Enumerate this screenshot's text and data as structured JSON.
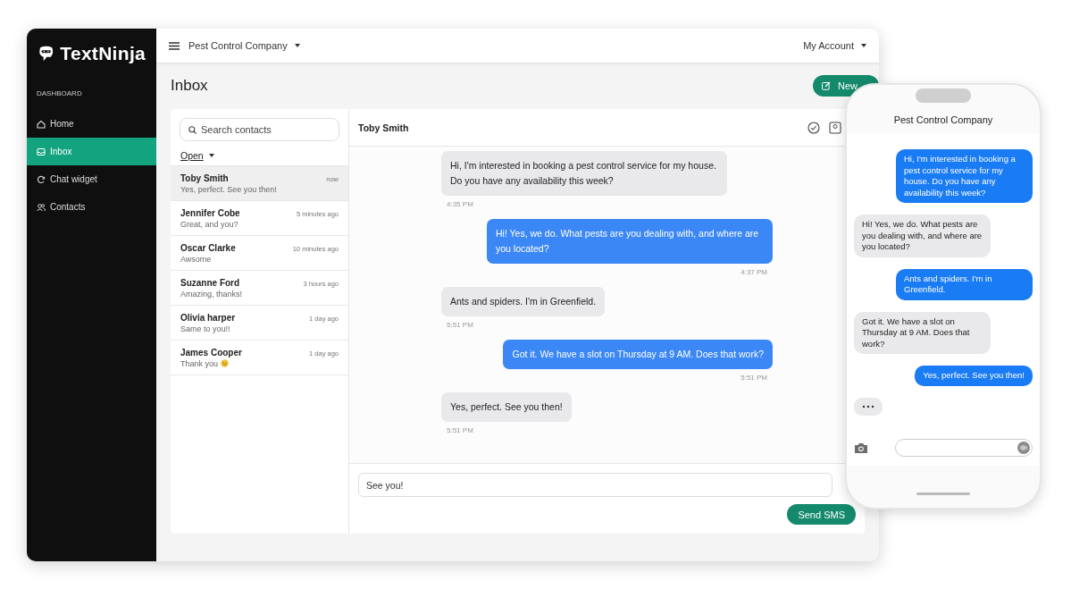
{
  "brand": {
    "name": "TextNinja"
  },
  "sidebar": {
    "section": "DASHBOARD",
    "items": [
      {
        "label": "Home",
        "selected": false
      },
      {
        "label": "Inbox",
        "selected": true
      },
      {
        "label": "Chat widget",
        "selected": false
      },
      {
        "label": "Contacts",
        "selected": false
      }
    ]
  },
  "topbar": {
    "company": "Pest Control Company",
    "account": "My Account"
  },
  "page": {
    "title": "Inbox",
    "new_button": "New"
  },
  "contacts": {
    "search_placeholder": "Search contacts",
    "filter": "Open",
    "items": [
      {
        "name": "Toby Smith",
        "preview": "Yes, perfect. See you then!",
        "time": "now",
        "emoji": false,
        "selected": true
      },
      {
        "name": "Jennifer Cobe",
        "preview": "Great, and you?",
        "time": "5 minutes ago",
        "emoji": false,
        "selected": false
      },
      {
        "name": "Oscar Clarke",
        "preview": "Awsome",
        "time": "10 minutes ago",
        "emoji": false,
        "selected": false
      },
      {
        "name": "Suzanne Ford",
        "preview": "Amazing, thanks!",
        "time": "3 hours ago",
        "emoji": false,
        "selected": false
      },
      {
        "name": "Olivia harper",
        "preview": "Same to you!!",
        "time": "1 day ago",
        "emoji": false,
        "selected": false
      },
      {
        "name": "James Cooper",
        "preview": "Thank you",
        "time": "1 day ago",
        "emoji": true,
        "selected": false
      }
    ]
  },
  "chat": {
    "contact": "Toby Smith",
    "messages": [
      {
        "kind": "in",
        "text": "Hi, I'm interested in booking a pest control service for my house. Do you have any availability this week?",
        "time": "4:35 PM"
      },
      {
        "kind": "out",
        "text": "Hi! Yes, we do. What pests are you dealing with, and where are you located?",
        "time": "4:37 PM"
      },
      {
        "kind": "in",
        "text": "Ants and spiders. I'm in Greenfield.",
        "time": "5:51 PM"
      },
      {
        "kind": "out",
        "text": "Got it. We have a slot on Thursday at 9 AM. Does that work?",
        "time": "5:51 PM"
      },
      {
        "kind": "in",
        "text": "Yes, perfect. See you then!",
        "time": "5:51 PM"
      }
    ],
    "composer_value": "See you!",
    "send_button": "Send SMS"
  },
  "phone": {
    "title": "Pest Control Company",
    "messages": [
      {
        "kind": "out",
        "text": "Hi, I'm interested in booking a pest control service for my house. Do you have any availability this week?"
      },
      {
        "kind": "in",
        "text": "Hi! Yes, we do. What pests are you dealing with, and where are you located?"
      },
      {
        "kind": "out",
        "text": "Ants and spiders. I'm in Greenfield."
      },
      {
        "kind": "in",
        "text": "Got it. We have a slot on Thursday at 9 AM. Does that work?"
      },
      {
        "kind": "out",
        "text": "Yes, perfect. See you then!"
      },
      {
        "kind": "typing"
      }
    ]
  }
}
